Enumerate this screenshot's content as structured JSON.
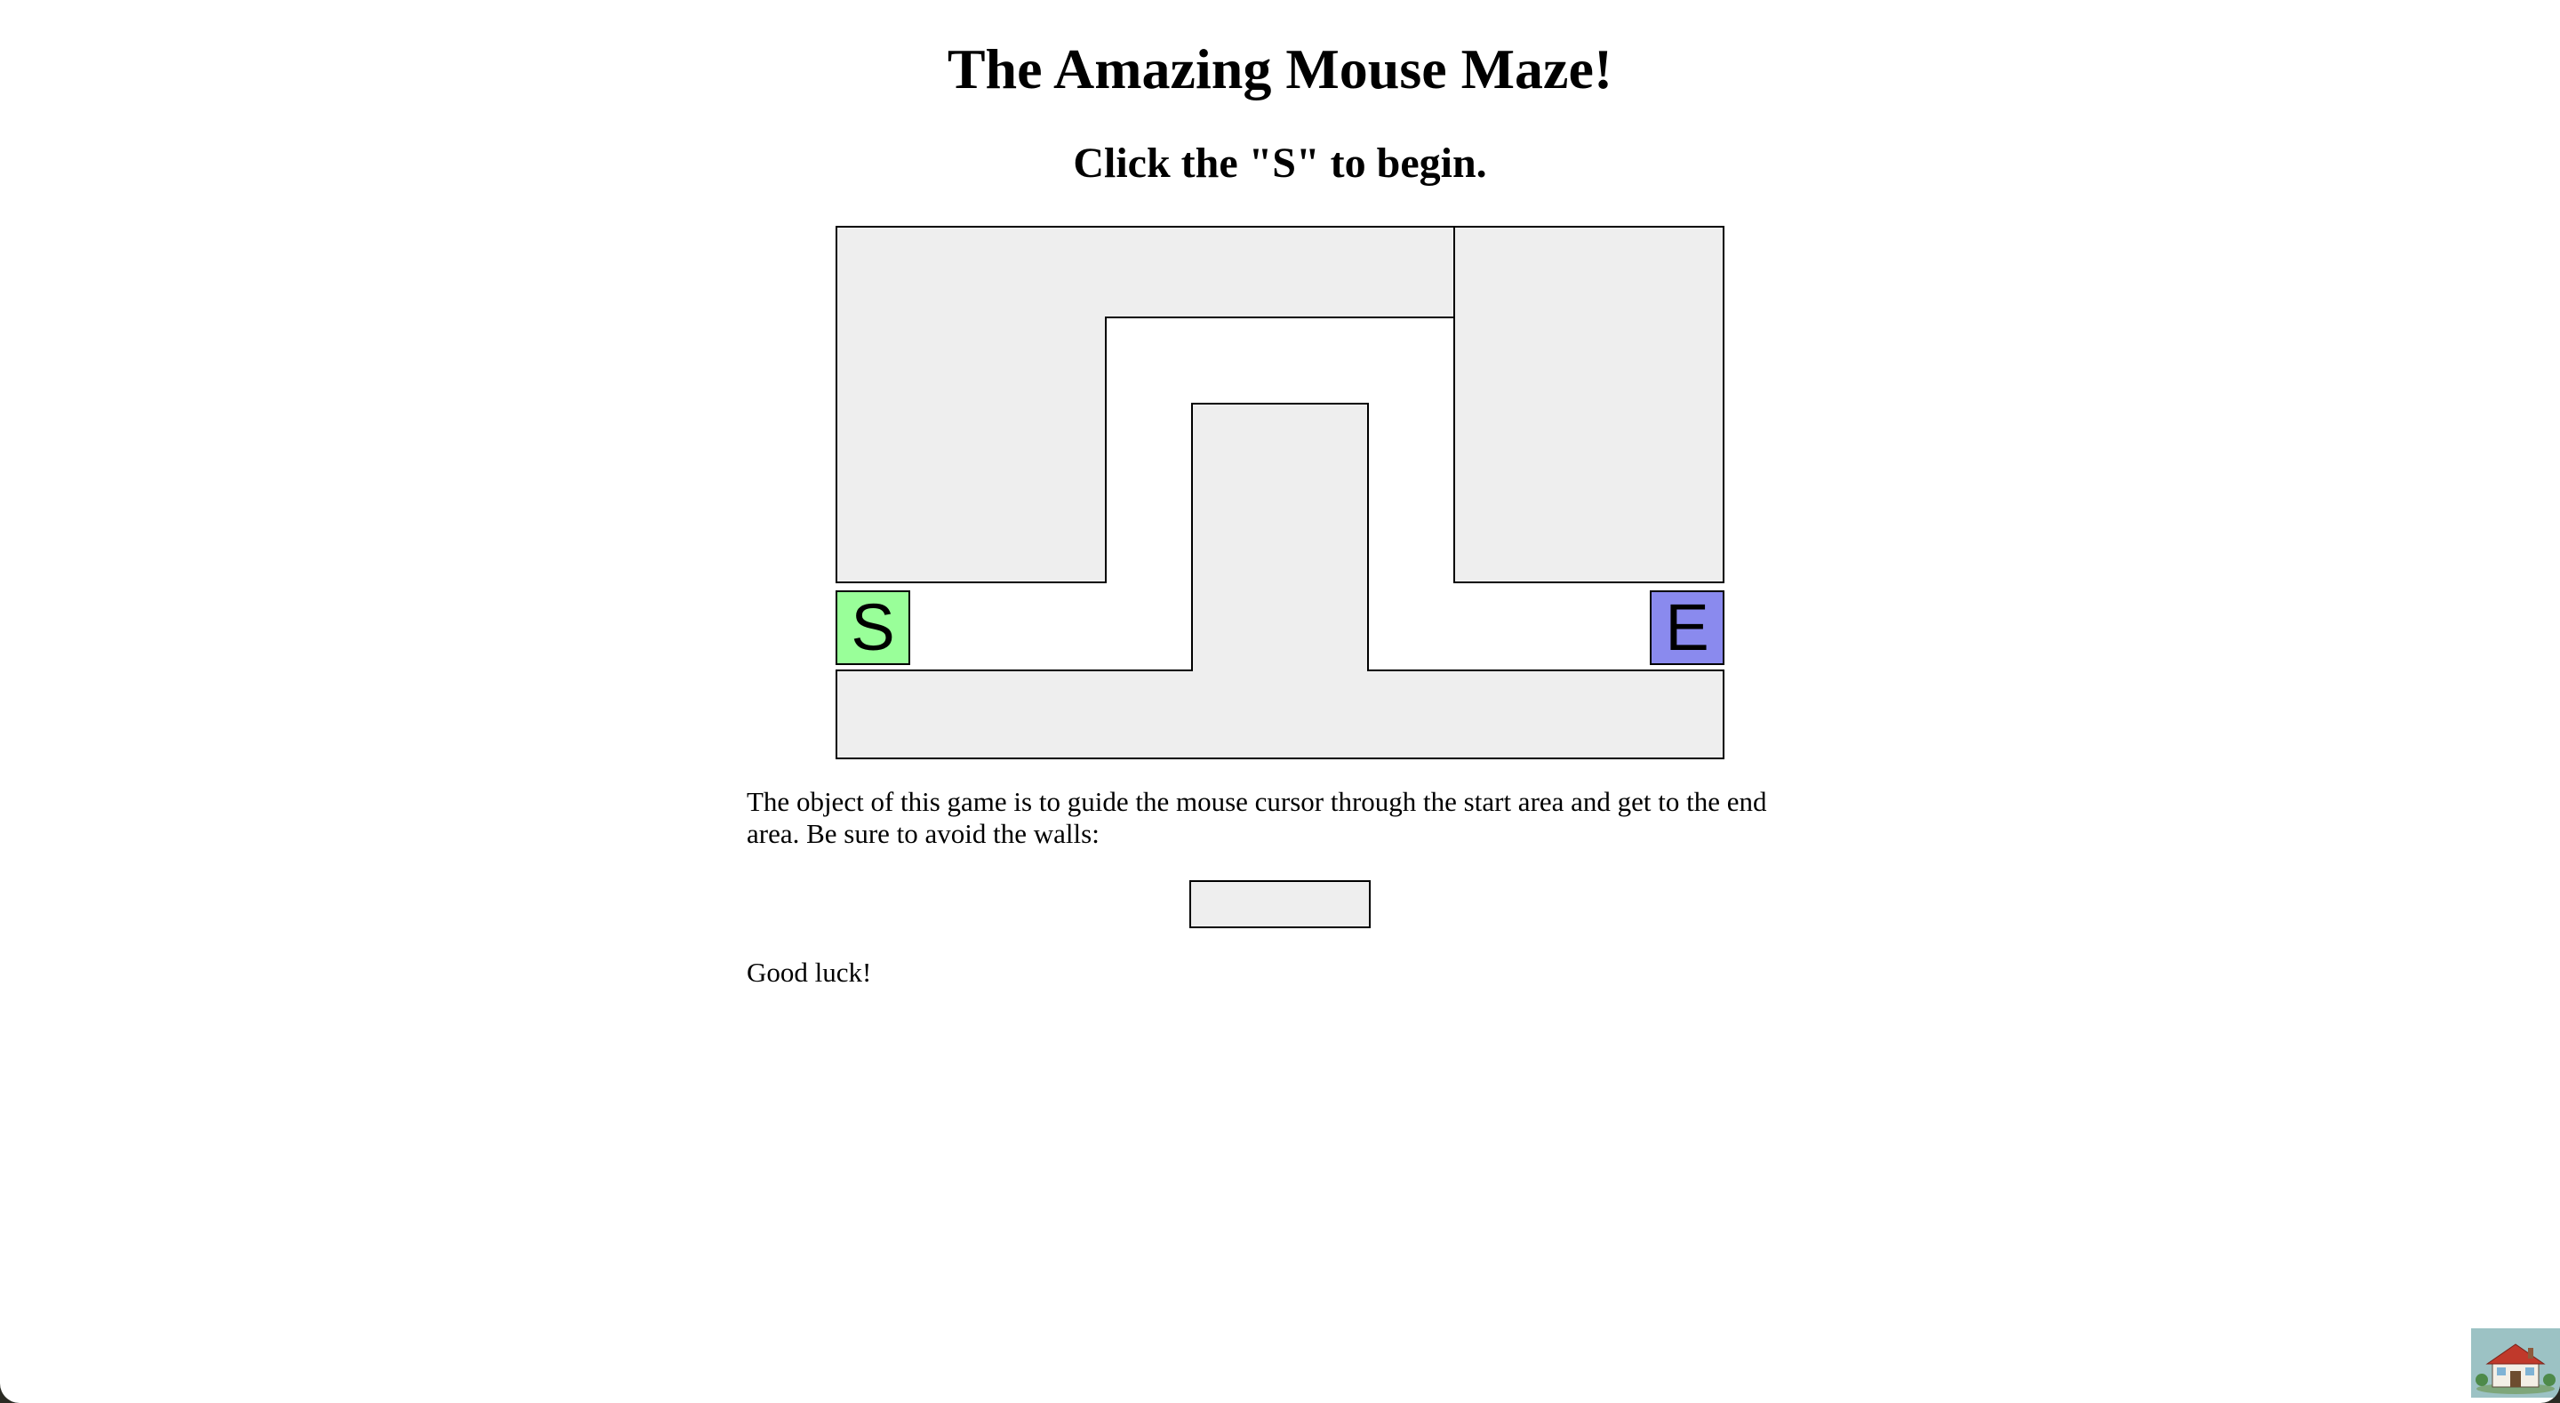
{
  "header": {
    "title": "The Amazing Mouse Maze!",
    "instruction": "Click the \"S\" to begin."
  },
  "maze": {
    "start_label": "S",
    "end_label": "E",
    "colors": {
      "wall": "#eeeeee",
      "start": "#99ff99",
      "end": "#8a8aee",
      "border": "#000000"
    }
  },
  "instructions": {
    "intro": "The object of this game is to guide the mouse cursor through the start area and get to the end area. Be sure to avoid the walls:",
    "closing": "Good luck!"
  },
  "badge": {
    "icon": "house-icon"
  }
}
